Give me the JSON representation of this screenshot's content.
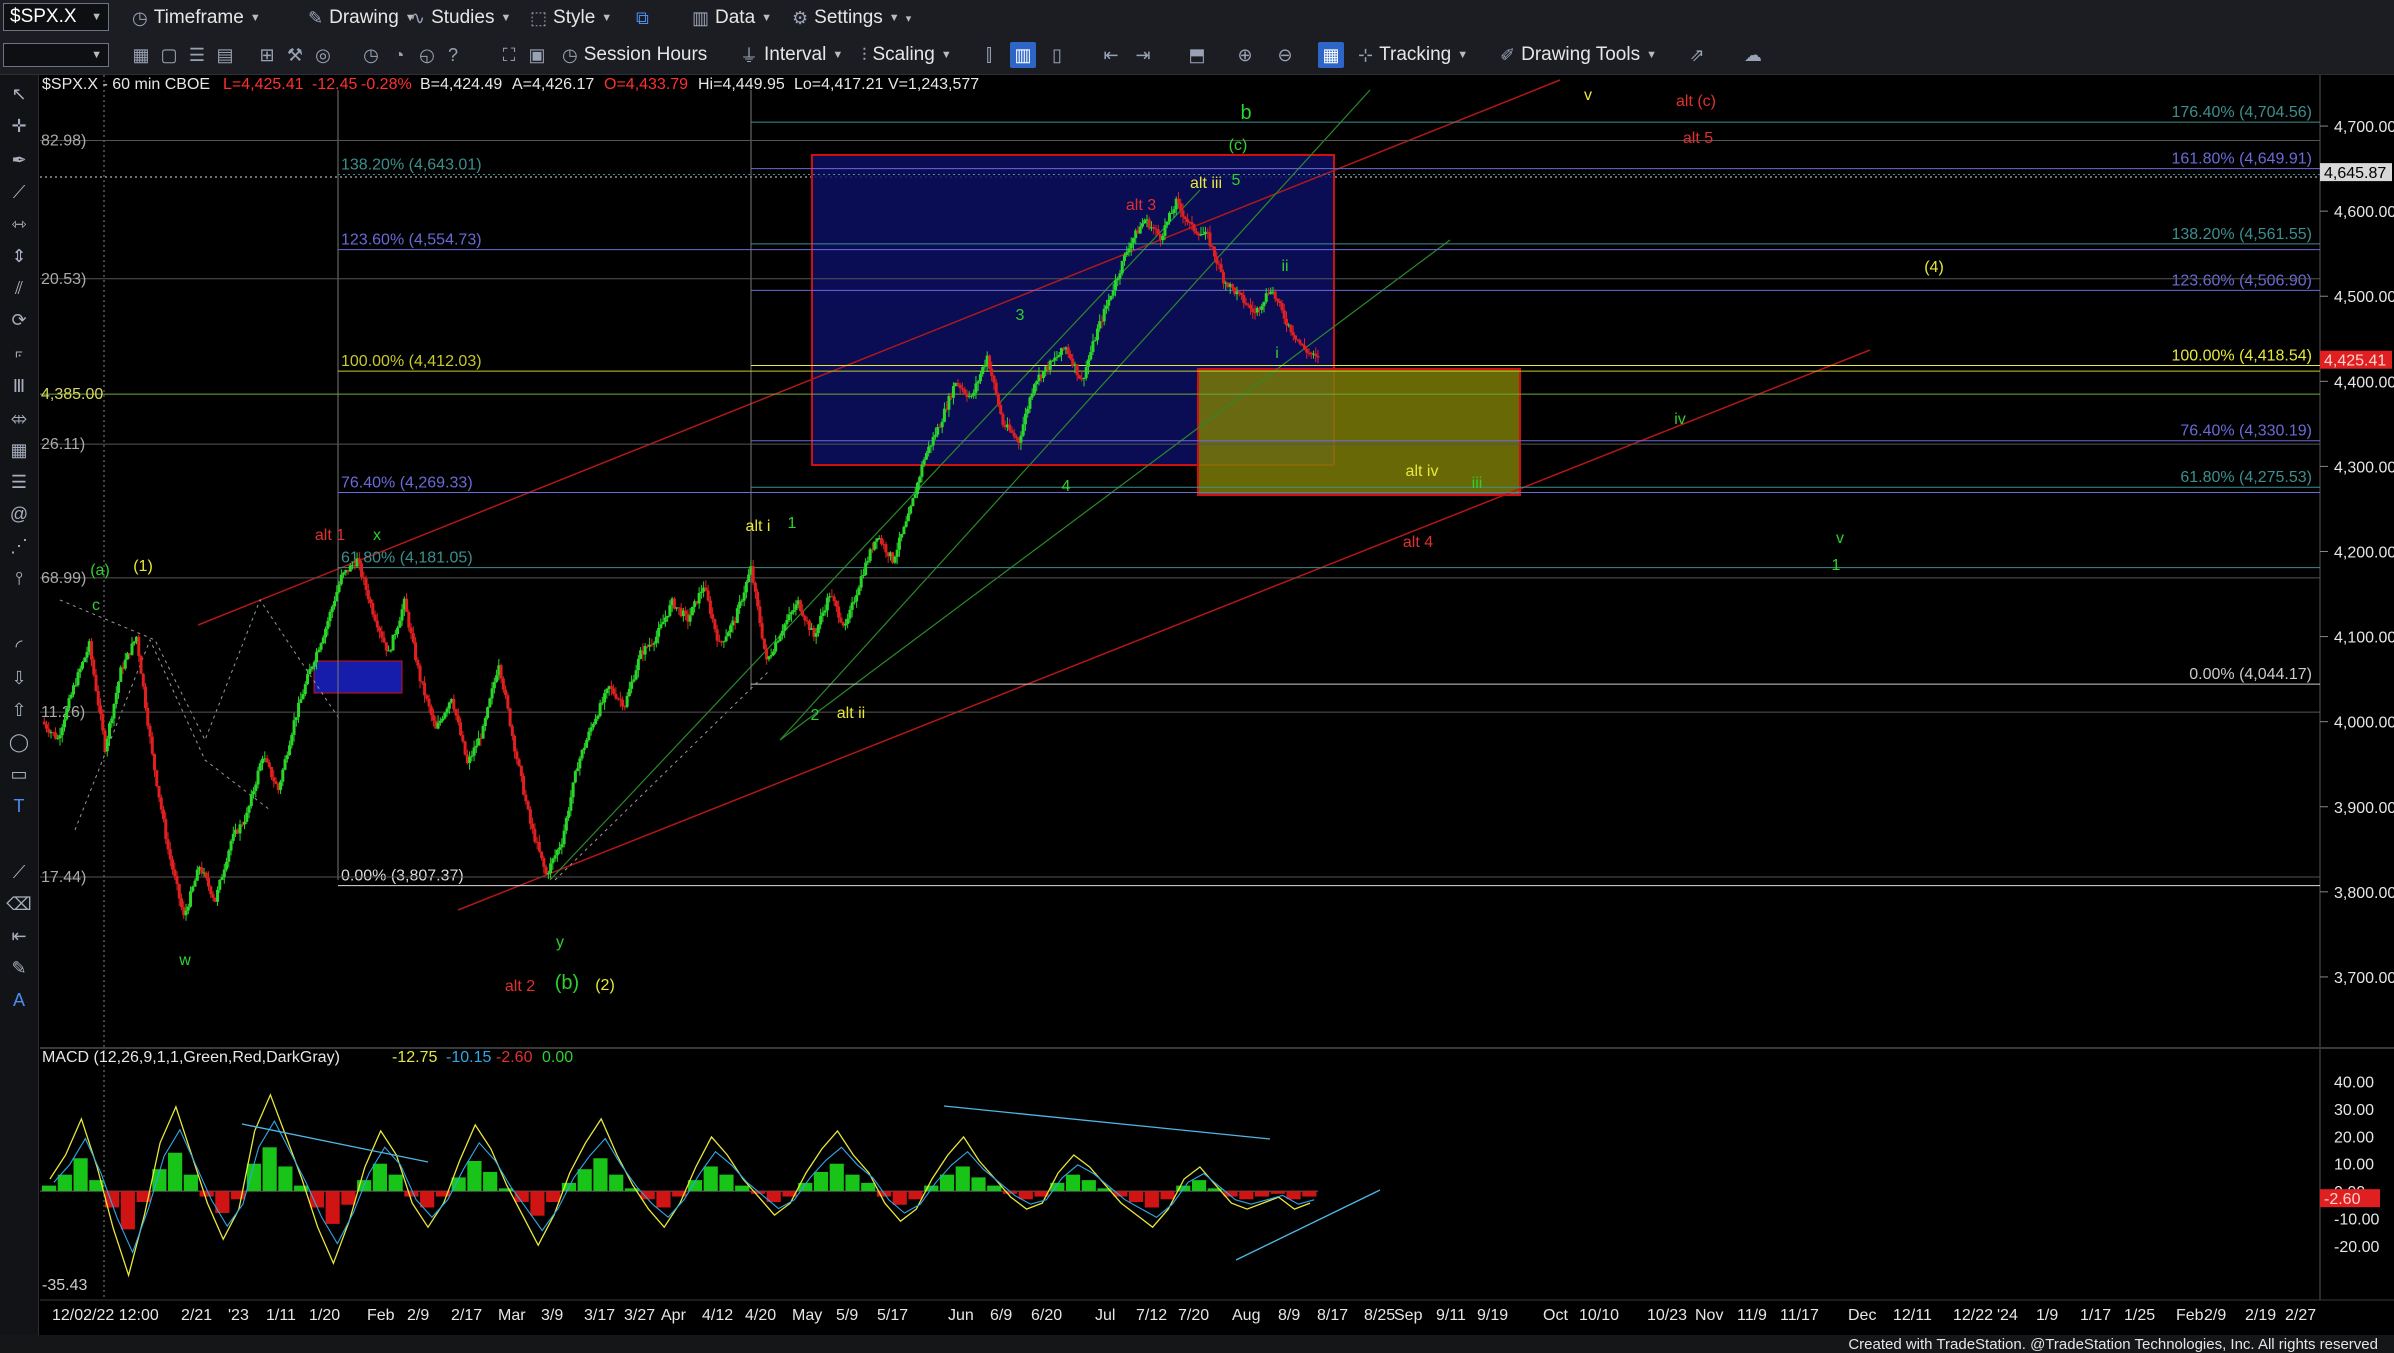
{
  "toolbar": {
    "symbol": "$SPX.X",
    "menus": [
      {
        "id": "timeframe",
        "label": "Timeframe",
        "icon": "clock-icon"
      },
      {
        "id": "drawing",
        "label": "Drawing",
        "icon": "pencil-icon"
      },
      {
        "id": "studies",
        "label": "Studies",
        "icon": "studies-icon"
      },
      {
        "id": "style",
        "label": "Style",
        "icon": "style-icon"
      },
      {
        "id": "data",
        "label": "Data",
        "icon": "bars-icon"
      },
      {
        "id": "settings",
        "label": "Settings",
        "icon": "gear-icon"
      }
    ],
    "row2": {
      "session_hours": "Session Hours",
      "interval": "Interval",
      "scaling": "Scaling",
      "tracking": "Tracking",
      "drawing_tools": "Drawing Tools"
    }
  },
  "chart_header": {
    "symbol_text": "$SPX.X - 60 min  CBOE",
    "last": "L=4,425.41",
    "change": "-12.45",
    "change_pct": "-0.28%",
    "bid": "B=4,424.49",
    "ask": "A=4,426.17",
    "open": "O=4,433.79",
    "high": "Hi=4,449.95",
    "low": "Lo=4,417.21",
    "volume": "V=1,243,577"
  },
  "macd_header": {
    "label": "MACD (12,26,9,1,1,Green,Red,DarkGray)",
    "macd": "-12.75",
    "signal": "-10.15",
    "hist": "-2.60",
    "zero": "0.00"
  },
  "chart_data": {
    "type": "candlestick",
    "symbol": "$SPX.X",
    "interval": "60 min",
    "y_axis_ticks": [
      "4,700.00",
      "4,600.00",
      "4,500.00",
      "4,400.00",
      "4,300.00",
      "4,200.00",
      "4,100.00",
      "4,000.00",
      "3,900.00",
      "3,800.00",
      "3,700.00"
    ],
    "y_axis_values": [
      4700,
      4600,
      4500,
      4400,
      4300,
      4200,
      4100,
      4000,
      3900,
      3800,
      3700
    ],
    "ylim": [
      3620,
      4760
    ],
    "price_markers": [
      {
        "value": 4645.87,
        "label": "4,645.87"
      },
      {
        "value": 4425.41,
        "label": "4,425.41"
      }
    ],
    "x_axis_ticks": [
      "12/02/22 12:00",
      "2/21",
      "'23",
      "1/11",
      "1/20",
      "Feb",
      "2/9",
      "2/17",
      "Mar",
      "3/9",
      "3/17",
      "3/27",
      "Apr",
      "4/12",
      "4/20",
      "May",
      "5/9",
      "5/17",
      "Jun",
      "6/9",
      "6/20",
      "Jul",
      "7/12",
      "7/20",
      "Aug",
      "8/9",
      "8/17",
      "8/25",
      "Sep",
      "9/11",
      "9/19",
      "Oct",
      "10/10",
      "10/23",
      "Nov",
      "11/9",
      "11/17",
      "Dec",
      "12/11",
      "12/22",
      "'24",
      "1/9",
      "1/17",
      "1/25",
      "Feb",
      "2/9",
      "2/19",
      "2/27"
    ],
    "price_path": [
      4000,
      3980,
      4040,
      4090,
      3970,
      4060,
      4100,
      3960,
      3850,
      3770,
      3830,
      3790,
      3860,
      3890,
      3960,
      3920,
      4000,
      4060,
      4110,
      4170,
      4190,
      4130,
      4080,
      4140,
      4050,
      3990,
      4030,
      3950,
      3990,
      4070,
      3970,
      3880,
      3820,
      3860,
      3950,
      4000,
      4040,
      4020,
      4080,
      4100,
      4140,
      4120,
      4160,
      4090,
      4120,
      4180,
      4070,
      4110,
      4140,
      4100,
      4150,
      4110,
      4170,
      4220,
      4190,
      4240,
      4310,
      4350,
      4400,
      4380,
      4430,
      4350,
      4330,
      4400,
      4420,
      4440,
      4400,
      4460,
      4510,
      4560,
      4590,
      4570,
      4610,
      4580,
      4570,
      4520,
      4500,
      4480,
      4510,
      4470,
      4440,
      4425
    ],
    "fib_levels_left": [
      {
        "label": "138.20% (4,643.01)",
        "value": 4643.01
      },
      {
        "label": "123.60% (4,554.73)",
        "value": 4554.73
      },
      {
        "label": "100.00% (4,412.03)",
        "value": 4412.03
      },
      {
        "label": "76.40% (4,269.33)",
        "value": 4269.33
      },
      {
        "label": "61.80% (4,181.05)",
        "value": 4181.05
      },
      {
        "label": "0.00% (3,807.37)",
        "value": 3807.37
      }
    ],
    "fib_levels_right": [
      {
        "label": "176.40% (4,704.56)",
        "value": 4704.56
      },
      {
        "label": "161.80% (4,649.91)",
        "value": 4649.91
      },
      {
        "label": "138.20% (4,561.55)",
        "value": 4561.55
      },
      {
        "label": "123.60% (4,506.90)",
        "value": 4506.9
      },
      {
        "label": "100.00% (4,418.54)",
        "value": 4418.54
      },
      {
        "label": "76.40% (4,330.19)",
        "value": 4330.19
      },
      {
        "label": "61.80% (4,275.53)",
        "value": 4275.53
      },
      {
        "label": "0.00% (4,044.17)",
        "value": 4044.17
      }
    ],
    "truncated_labels": [
      {
        "text": "82.98)",
        "value": 4682.98
      },
      {
        "text": "20.53)",
        "value": 4520.53
      },
      {
        "text": "4,385.00",
        "value": 4385.0
      },
      {
        "text": "26.11)",
        "value": 4326.11
      },
      {
        "text": "68.99)",
        "value": 4168.99
      },
      {
        "text": "11.26)",
        "value": 4011.26
      },
      {
        "text": "17.44)",
        "value": 3817.44
      }
    ],
    "wave_labels": [
      {
        "text": "b",
        "color": "#2fd12f"
      },
      {
        "text": "(c)",
        "color": "#2fd12f"
      },
      {
        "text": "5",
        "color": "#2fd12f"
      },
      {
        "text": "alt iii",
        "color": "#e8e83a"
      },
      {
        "text": "alt 3",
        "color": "#e03030"
      },
      {
        "text": "3",
        "color": "#2fd12f"
      },
      {
        "text": "ii",
        "color": "#2fd12f"
      },
      {
        "text": "i",
        "color": "#2fd12f"
      },
      {
        "text": "4",
        "color": "#2fd12f"
      },
      {
        "text": "alt i",
        "color": "#e8e83a"
      },
      {
        "text": "1",
        "color": "#2fd12f"
      },
      {
        "text": "2",
        "color": "#2fd12f"
      },
      {
        "text": "alt ii",
        "color": "#e8e83a"
      },
      {
        "text": "alt iv",
        "color": "#e8e83a"
      },
      {
        "text": "iii",
        "color": "#2fd12f"
      },
      {
        "text": "alt 4",
        "color": "#e03030"
      },
      {
        "text": "iv",
        "color": "#2fd12f"
      },
      {
        "text": "v",
        "color": "#2fd12f"
      },
      {
        "text": "1",
        "color": "#2fd12f"
      },
      {
        "text": "(4)",
        "color": "#e8e83a"
      },
      {
        "text": "v",
        "color": "#e8e83a"
      },
      {
        "text": "alt (c)",
        "color": "#e03030"
      },
      {
        "text": "alt 5",
        "color": "#e03030"
      },
      {
        "text": "alt 1",
        "color": "#e03030"
      },
      {
        "text": "x",
        "color": "#2fd12f"
      },
      {
        "text": "(a)",
        "color": "#2fd12f"
      },
      {
        "text": "(1)",
        "color": "#e8e83a"
      },
      {
        "text": "c",
        "color": "#2fd12f"
      },
      {
        "text": "w",
        "color": "#2fd12f"
      },
      {
        "text": "y",
        "color": "#2fd12f"
      },
      {
        "text": "alt 2",
        "color": "#e03030"
      },
      {
        "text": "(b)",
        "color": "#2fd12f"
      },
      {
        "text": "(2)",
        "color": "#e8e83a"
      }
    ],
    "macd_axis_ticks": [
      "40.00",
      "30.00",
      "20.00",
      "10.00",
      "0.00",
      "-10.00",
      "-20.00"
    ],
    "macd_axis_values": [
      40,
      30,
      20,
      10,
      0,
      -10,
      -20
    ],
    "macd_ylim": [
      -38,
      45
    ],
    "macd_min_label": "-35.43",
    "macd_marker": "-2.60",
    "macd_hist": [
      2,
      6,
      12,
      4,
      -6,
      -14,
      -4,
      8,
      14,
      6,
      -2,
      -8,
      -3,
      10,
      16,
      9,
      2,
      -6,
      -12,
      -5,
      4,
      10,
      6,
      -2,
      -6,
      -2,
      5,
      11,
      7,
      1,
      -4,
      -9,
      -4,
      3,
      8,
      12,
      6,
      1,
      -3,
      -6,
      -2,
      4,
      9,
      6,
      2,
      -1,
      -4,
      -2,
      3,
      7,
      10,
      6,
      3,
      -2,
      -5,
      -3,
      2,
      6,
      9,
      5,
      2,
      -1,
      -3,
      -2,
      3,
      6,
      4,
      1,
      -2,
      -4,
      -6,
      -3,
      2,
      4,
      1,
      -2,
      -3,
      -2,
      -1,
      -3,
      -2
    ],
    "colors": {
      "up": "#2bd62b",
      "down": "#e02020",
      "hist_up": "#17c417",
      "hist_down": "#d01414"
    }
  },
  "footer": "Created with TradeStation. @TradeStation Technologies, Inc. All rights reserved"
}
